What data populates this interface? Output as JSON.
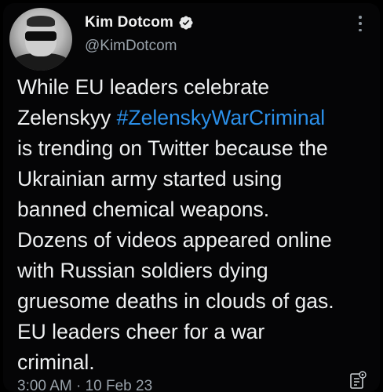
{
  "author": {
    "display_name": "Kim Dotcom",
    "handle": "@KimDotcom",
    "verified": true,
    "avatar_icon": "profile-photo"
  },
  "tweet": {
    "text_part1": "While EU leaders celebrate\nZelenskyy ",
    "hashtag": "#ZelenskyWarCriminal",
    "text_part2": "\nis trending on Twitter because the\nUkrainian army started using\nbanned chemical weapons.\nDozens of videos appeared online\nwith Russian soldiers dying\ngruesome deaths in clouds of gas.\nEU leaders cheer for a war\ncriminal.",
    "timestamp": "3:00 AM · 10 Feb 23"
  },
  "icons": {
    "more": "more-options-icon",
    "verified": "verified-badge-icon",
    "stats": "view-stats-icon"
  },
  "colors": {
    "background": "#050506",
    "text": "#e7e9ea",
    "secondary": "#9aa3ab",
    "hashtag": "#2b8fe8"
  }
}
